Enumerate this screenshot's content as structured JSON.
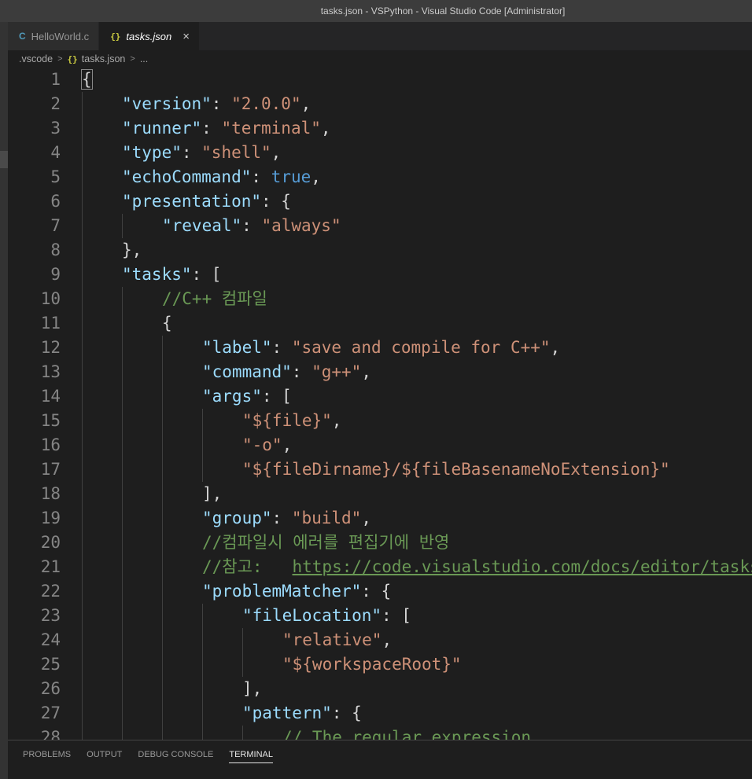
{
  "window": {
    "title": "tasks.json - VSPython - Visual Studio Code [Administrator]"
  },
  "tabs": [
    {
      "label": "HelloWorld.c",
      "icon": "c-file-icon",
      "icon_glyph": "C",
      "active": false
    },
    {
      "label": "tasks.json",
      "icon": "json-file-icon",
      "icon_glyph": "{}",
      "active": true,
      "close_glyph": "×"
    }
  ],
  "breadcrumb": {
    "folder": ".vscode",
    "file": "tasks.json",
    "icon_glyph": "{}",
    "more": "...",
    "separator": ">"
  },
  "editor": {
    "lines": [
      {
        "n": "1",
        "indent": 0,
        "tokens": [
          [
            "punc",
            "{"
          ]
        ]
      },
      {
        "n": "2",
        "indent": 1,
        "tokens": [
          [
            "key",
            "\"version\""
          ],
          [
            "punc",
            ": "
          ],
          [
            "str",
            "\"2.0.0\""
          ],
          [
            "punc",
            ","
          ]
        ]
      },
      {
        "n": "3",
        "indent": 1,
        "tokens": [
          [
            "key",
            "\"runner\""
          ],
          [
            "punc",
            ": "
          ],
          [
            "str",
            "\"terminal\""
          ],
          [
            "punc",
            ","
          ]
        ]
      },
      {
        "n": "4",
        "indent": 1,
        "tokens": [
          [
            "key",
            "\"type\""
          ],
          [
            "punc",
            ": "
          ],
          [
            "str",
            "\"shell\""
          ],
          [
            "punc",
            ","
          ]
        ]
      },
      {
        "n": "5",
        "indent": 1,
        "tokens": [
          [
            "key",
            "\"echoCommand\""
          ],
          [
            "punc",
            ": "
          ],
          [
            "bool",
            "true"
          ],
          [
            "punc",
            ","
          ]
        ]
      },
      {
        "n": "6",
        "indent": 1,
        "tokens": [
          [
            "key",
            "\"presentation\""
          ],
          [
            "punc",
            ": {"
          ]
        ]
      },
      {
        "n": "7",
        "indent": 2,
        "tokens": [
          [
            "key",
            "\"reveal\""
          ],
          [
            "punc",
            ": "
          ],
          [
            "str",
            "\"always\""
          ]
        ]
      },
      {
        "n": "8",
        "indent": 1,
        "tokens": [
          [
            "punc",
            "},"
          ]
        ]
      },
      {
        "n": "9",
        "indent": 1,
        "tokens": [
          [
            "key",
            "\"tasks\""
          ],
          [
            "punc",
            ": ["
          ]
        ]
      },
      {
        "n": "10",
        "indent": 2,
        "tokens": [
          [
            "cmt",
            "//C++ 컴파일"
          ]
        ]
      },
      {
        "n": "11",
        "indent": 2,
        "tokens": [
          [
            "punc",
            "{"
          ]
        ]
      },
      {
        "n": "12",
        "indent": 3,
        "tokens": [
          [
            "key",
            "\"label\""
          ],
          [
            "punc",
            ": "
          ],
          [
            "str",
            "\"save and compile for C++\""
          ],
          [
            "punc",
            ","
          ]
        ]
      },
      {
        "n": "13",
        "indent": 3,
        "tokens": [
          [
            "key",
            "\"command\""
          ],
          [
            "punc",
            ": "
          ],
          [
            "str",
            "\"g++\""
          ],
          [
            "punc",
            ","
          ]
        ]
      },
      {
        "n": "14",
        "indent": 3,
        "tokens": [
          [
            "key",
            "\"args\""
          ],
          [
            "punc",
            ": ["
          ]
        ]
      },
      {
        "n": "15",
        "indent": 4,
        "tokens": [
          [
            "str",
            "\"${file}\""
          ],
          [
            "punc",
            ","
          ]
        ]
      },
      {
        "n": "16",
        "indent": 4,
        "tokens": [
          [
            "str",
            "\"-o\""
          ],
          [
            "punc",
            ","
          ]
        ]
      },
      {
        "n": "17",
        "indent": 4,
        "tokens": [
          [
            "str",
            "\"${fileDirname}/${fileBasenameNoExtension}\""
          ]
        ]
      },
      {
        "n": "18",
        "indent": 3,
        "tokens": [
          [
            "punc",
            "],"
          ]
        ]
      },
      {
        "n": "19",
        "indent": 3,
        "tokens": [
          [
            "key",
            "\"group\""
          ],
          [
            "punc",
            ": "
          ],
          [
            "str",
            "\"build\""
          ],
          [
            "punc",
            ","
          ]
        ]
      },
      {
        "n": "20",
        "indent": 3,
        "tokens": [
          [
            "cmt",
            "//컴파일시 에러를 편집기에 반영"
          ]
        ]
      },
      {
        "n": "21",
        "indent": 3,
        "tokens": [
          [
            "cmt",
            "//참고:   "
          ],
          [
            "link",
            "https://code.visualstudio.com/docs/editor/tasks"
          ]
        ]
      },
      {
        "n": "22",
        "indent": 3,
        "tokens": [
          [
            "key",
            "\"problemMatcher\""
          ],
          [
            "punc",
            ": {"
          ]
        ]
      },
      {
        "n": "23",
        "indent": 4,
        "tokens": [
          [
            "key",
            "\"fileLocation\""
          ],
          [
            "punc",
            ": ["
          ]
        ]
      },
      {
        "n": "24",
        "indent": 5,
        "tokens": [
          [
            "str",
            "\"relative\""
          ],
          [
            "punc",
            ","
          ]
        ]
      },
      {
        "n": "25",
        "indent": 5,
        "tokens": [
          [
            "str",
            "\"${workspaceRoot}\""
          ]
        ]
      },
      {
        "n": "26",
        "indent": 4,
        "tokens": [
          [
            "punc",
            "],"
          ]
        ]
      },
      {
        "n": "27",
        "indent": 4,
        "tokens": [
          [
            "key",
            "\"pattern\""
          ],
          [
            "punc",
            ": {"
          ]
        ]
      },
      {
        "n": "28",
        "indent": 5,
        "tokens": [
          [
            "cmt",
            "// The regular expression"
          ]
        ]
      }
    ]
  },
  "panel": {
    "tabs": [
      {
        "label": "PROBLEMS",
        "active": false
      },
      {
        "label": "OUTPUT",
        "active": false
      },
      {
        "label": "DEBUG CONSOLE",
        "active": false
      },
      {
        "label": "TERMINAL",
        "active": true
      }
    ]
  },
  "colors": {
    "key": "#9cdcfe",
    "string": "#ce9178",
    "boolean": "#569cd6",
    "comment": "#6a9955",
    "background": "#1e1e1e"
  }
}
